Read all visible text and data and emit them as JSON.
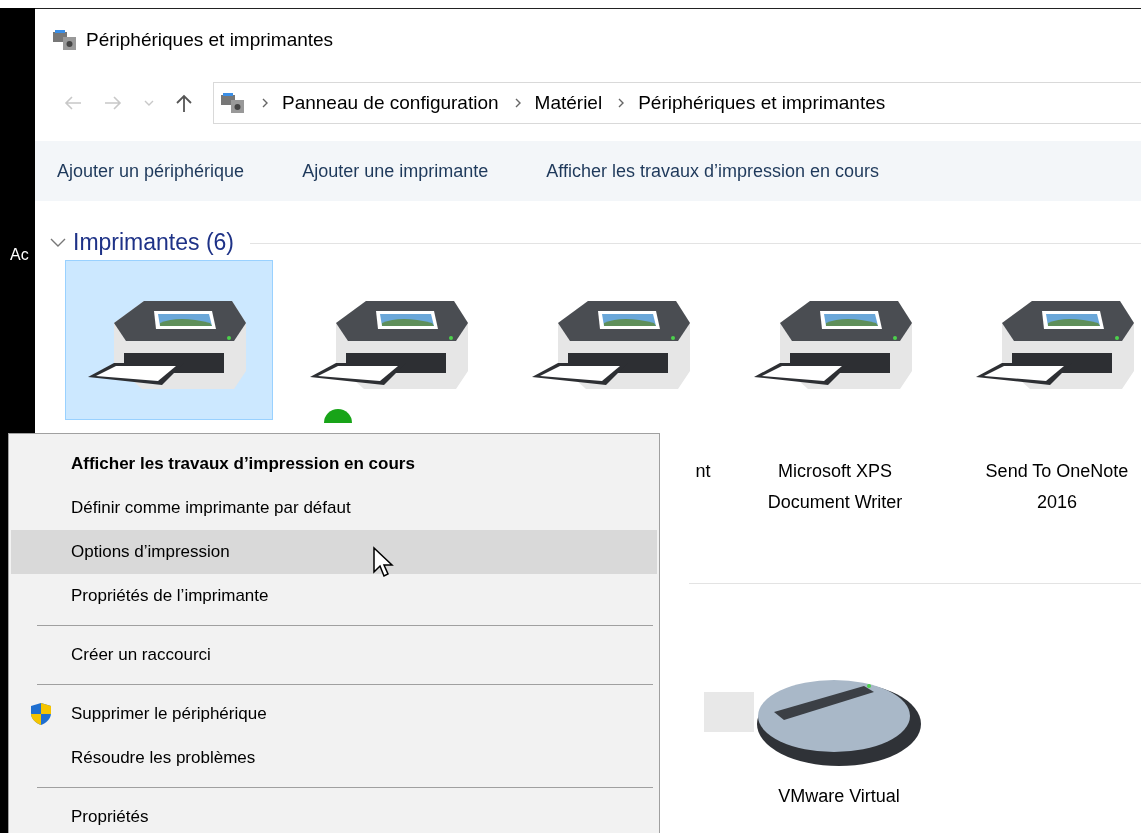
{
  "background_window": {
    "text": "Ac"
  },
  "window": {
    "title": "Périphériques et imprimantes"
  },
  "address_bar": {
    "path": [
      "Panneau de configuration",
      "Matériel",
      "Périphériques et imprimantes"
    ]
  },
  "toolbar": [
    "Ajouter un périphérique",
    "Ajouter une imprimante",
    "Afficher les travaux d’impression en cours"
  ],
  "printers_section": {
    "title": "Imprimantes (6)",
    "expanded": true,
    "items": [
      {
        "selected": true,
        "default": false
      },
      {
        "selected": false,
        "default": true
      },
      {
        "label": "nt",
        "selected": false,
        "default": false
      },
      {
        "label": "Microsoft XPS Document Writer",
        "selected": false,
        "default": false
      },
      {
        "label": "Send To OneNote 2016",
        "selected": false,
        "default": false
      }
    ]
  },
  "devices": [
    {
      "kind": "box"
    },
    {
      "kind": "mouse",
      "label": "VMware Virtual"
    }
  ],
  "context_menu": [
    {
      "kind": "default",
      "label": "Afficher les travaux d’impression en cours",
      "selected": false
    },
    {
      "kind": "item",
      "label": "Définir comme imprimante par défaut",
      "selected": false
    },
    {
      "kind": "item",
      "label": "Options d’impression",
      "selected": true
    },
    {
      "kind": "item",
      "label": "Propriétés de l’imprimante",
      "selected": false
    },
    {
      "kind": "separator"
    },
    {
      "kind": "item",
      "label": "Créer un raccourci",
      "selected": false
    },
    {
      "kind": "separator"
    },
    {
      "kind": "admin",
      "label": "Supprimer le périphérique",
      "selected": false
    },
    {
      "kind": "item",
      "label": "Résoudre les problèmes",
      "selected": false
    },
    {
      "kind": "separator"
    },
    {
      "kind": "item",
      "label": "Propriétés",
      "selected": false
    }
  ]
}
